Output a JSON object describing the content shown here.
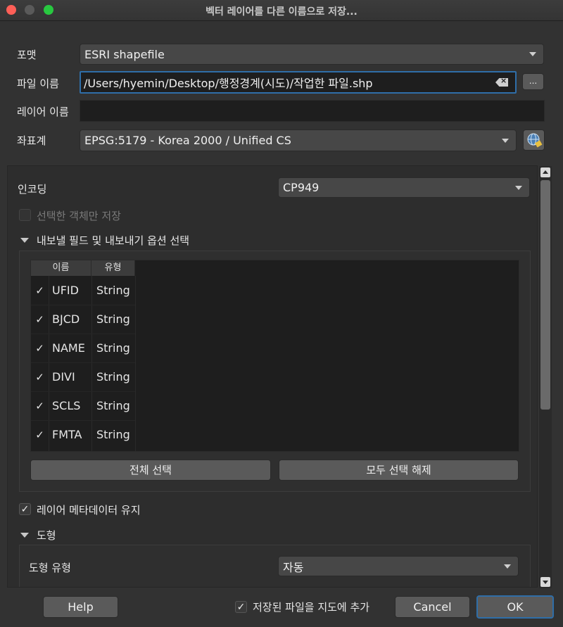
{
  "window": {
    "title": "벡터 레이어를 다른 이름으로 저장..."
  },
  "form": {
    "format_label": "포맷",
    "format_value": "ESRI shapefile",
    "filename_label": "파일 이름",
    "filename_value": "/Users/hyemin/Desktop/행정경계(시도)/작업한 파일.shp",
    "browse_label": "...",
    "layer_name_label": "레이어 이름",
    "layer_name_value": "",
    "crs_label": "좌표계",
    "crs_value": "EPSG:5179 - Korea 2000 / Unified CS"
  },
  "options": {
    "encoding_label": "인코딩",
    "encoding_value": "CP949",
    "selected_only_label": "선택한 객체만 저장",
    "selected_only_checked": false,
    "fields_section_label": "내보낼 필드 및 내보내기 옵션 선택",
    "fields_table": {
      "headers": [
        "이름",
        "유형"
      ],
      "rows": [
        {
          "checked": "✓",
          "name": "UFID",
          "type": "String"
        },
        {
          "checked": "✓",
          "name": "BJCD",
          "type": "String"
        },
        {
          "checked": "✓",
          "name": "NAME",
          "type": "String"
        },
        {
          "checked": "✓",
          "name": "DIVI",
          "type": "String"
        },
        {
          "checked": "✓",
          "name": "SCLS",
          "type": "String"
        },
        {
          "checked": "✓",
          "name": "FMTA",
          "type": "String"
        }
      ]
    },
    "select_all_label": "전체 선택",
    "deselect_all_label": "모두 선택 해제",
    "keep_metadata_label": "레이어 메타데이터 유지",
    "keep_metadata_check": "✓",
    "geometry_section_label": "도형",
    "geometry_type_label": "도형 유형",
    "geometry_type_value": "자동"
  },
  "footer": {
    "help_label": "Help",
    "add_to_map_label": "저장된 파일을 지도에 추가",
    "add_to_map_check": "✓",
    "cancel_label": "Cancel",
    "ok_label": "OK"
  },
  "colors": {
    "focus_accent": "#2f6ea8",
    "close": "#fe5f57",
    "zoom": "#28c840"
  }
}
